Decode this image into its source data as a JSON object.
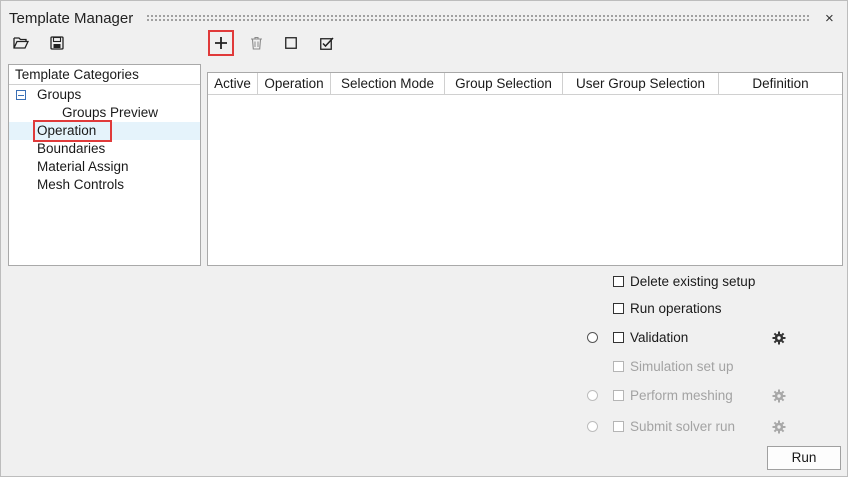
{
  "window": {
    "title": "Template Manager",
    "close_glyph": "×"
  },
  "toolbar": {
    "open_icon": "folder-open-icon",
    "save_icon": "save-icon",
    "add_icon": "plus-icon",
    "delete_icon": "trash-icon",
    "deselect_icon": "empty-checkbox-icon",
    "select_icon": "checked-checkbox-icon"
  },
  "categories": {
    "header": "Template Categories",
    "items": [
      {
        "label": "Groups"
      },
      {
        "label": "Groups Preview"
      },
      {
        "label": "Operation"
      },
      {
        "label": "Boundaries"
      },
      {
        "label": "Material Assign"
      },
      {
        "label": "Mesh Controls"
      }
    ]
  },
  "table": {
    "columns": [
      "Active",
      "Operation",
      "Selection Mode",
      "Group Selection",
      "User Group Selection",
      "Definition"
    ],
    "rows": []
  },
  "options": [
    {
      "label": "Delete existing setup",
      "enabled": true
    },
    {
      "label": "Run operations",
      "enabled": true
    },
    {
      "label": "Validation",
      "enabled": true
    },
    {
      "label": "Simulation set up",
      "enabled": false
    },
    {
      "label": "Perform meshing",
      "enabled": false
    },
    {
      "label": "Submit solver run",
      "enabled": false
    }
  ],
  "actions": {
    "run_label": "Run"
  },
  "colors": {
    "highlight": "#e03a3a",
    "selected_row": "#e5f3fb",
    "disabled_text": "#a3a3a3"
  }
}
